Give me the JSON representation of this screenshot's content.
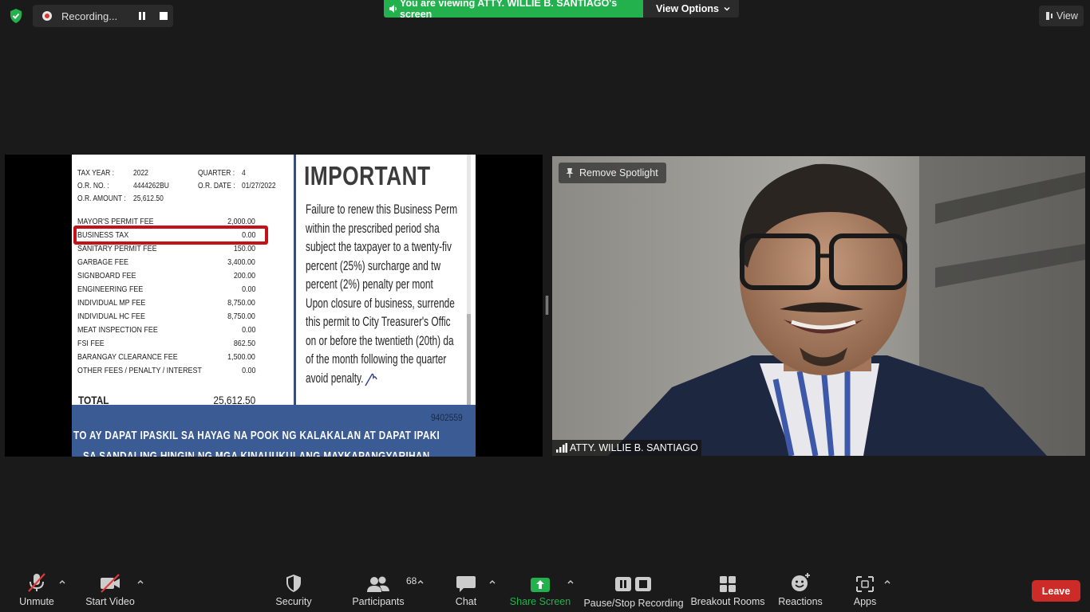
{
  "recording": {
    "status": "Recording..."
  },
  "share_banner": {
    "text": "You are viewing ATTY. WILLIE B. SANTIAGO's screen",
    "view_options": "View Options"
  },
  "view_button": "View",
  "permit": {
    "tax_year_label": "TAX YEAR :",
    "tax_year": "2022",
    "or_no_label": "O.R. NO. :",
    "or_no": "4444262BU",
    "or_amount_label": "O.R. AMOUNT :",
    "or_amount": "25,612.50",
    "quarter_label": "QUARTER :",
    "quarter": "4",
    "or_date_label": "O.R. DATE :",
    "or_date": "01/27/2022",
    "fees": [
      {
        "label": "MAYOR'S PERMIT FEE",
        "amount": "2,000.00"
      },
      {
        "label": "BUSINESS TAX",
        "amount": "0.00"
      },
      {
        "label": "SANITARY PERMIT FEE",
        "amount": "150.00"
      },
      {
        "label": "GARBAGE FEE",
        "amount": "3,400.00"
      },
      {
        "label": "SIGNBOARD FEE",
        "amount": "200.00"
      },
      {
        "label": "ENGINEERING FEE",
        "amount": "0.00"
      },
      {
        "label": "INDIVIDUAL MP FEE",
        "amount": "8,750.00"
      },
      {
        "label": "INDIVIDUAL HC FEE",
        "amount": "8,750.00"
      },
      {
        "label": "MEAT INSPECTION FEE",
        "amount": "0.00"
      },
      {
        "label": "FSI FEE",
        "amount": "862.50"
      },
      {
        "label": "BARANGAY CLEARANCE FEE",
        "amount": "1,500.00"
      },
      {
        "label": "OTHER FEES / PENALTY / INTEREST",
        "amount": "0.00"
      }
    ],
    "total_label": "TOTAL",
    "total_amount": "25,612.50",
    "important_title": "IMPORTANT",
    "important_text": "Failure to renew this Business Perm\nwithin the prescribed period sha\nsubject the taxpayer to a twenty-fiv\npercent (25%) surcharge and tw\npercent (2%) penalty per mont\nUpon closure of business, surrende\nthis permit to City Treasurer's Offic\non or before the twentieth (20th) da\nof the month following the quarter\navoid penalty.",
    "serial": "9402559",
    "banner_line1": "TO AY DAPAT IPASKIL SA HAYAG NA POOK NG KALAKALAN AT DAPAT IPAKI",
    "banner_line2": "SA SANDALING HINGIN NG MGA KINAUUKULANG MAYKAPANGYARIHAN"
  },
  "video": {
    "spotlight_label": "Remove Spotlight",
    "participant_name": "ATTY. WILLIE B. SANTIAGO"
  },
  "toolbar": {
    "unmute": "Unmute",
    "start_video": "Start Video",
    "security": "Security",
    "participants": "Participants",
    "participants_count": "68",
    "chat": "Chat",
    "share_screen": "Share Screen",
    "pause_stop_recording": "Pause/Stop Recording",
    "breakout_rooms": "Breakout Rooms",
    "reactions": "Reactions",
    "apps": "Apps",
    "leave": "Leave"
  },
  "colors": {
    "share_green": "#23b14d",
    "leave_red": "#cc2b27",
    "highlight_red": "#c4121a"
  }
}
